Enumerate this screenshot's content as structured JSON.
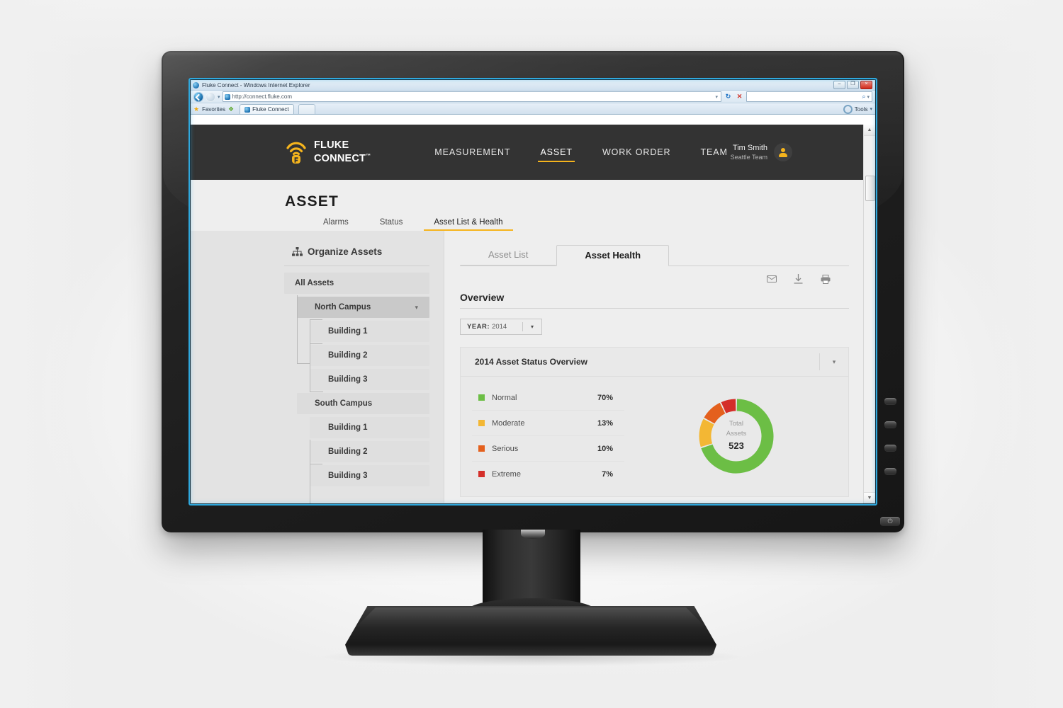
{
  "browser": {
    "window_title": "Fluke Connect - Windows Internet Explorer",
    "url": "http://connect.fluke.com",
    "favorites_label": "Favorites",
    "tab_label": "Fluke Connect",
    "tools_label": "Tools",
    "minimize_glyph": "–",
    "maximize_glyph": "❐",
    "close_glyph": "×",
    "back_caret": "▾",
    "url_caret": "▾",
    "refresh_glyph": "↻",
    "stop_glyph": "✕",
    "search_glyph": "⌕",
    "search_caret": "▾",
    "star_glyph": "★",
    "add_fav_glyph": "❖",
    "tools_caret": "▾",
    "scroll_up_glyph": "▲",
    "scroll_down_glyph": "▼"
  },
  "app": {
    "logo_line1": "FLUKE",
    "logo_line2": "CONNECT",
    "logo_tm": "™",
    "nav": [
      {
        "label": "MEASUREMENT",
        "active": false
      },
      {
        "label": "ASSET",
        "active": true
      },
      {
        "label": "WORK ORDER",
        "active": false
      },
      {
        "label": "TEAM",
        "active": false
      }
    ],
    "user": {
      "name": "Tim Smith",
      "team": "Seattle Team"
    },
    "accent": "#f5b41d",
    "header_bg": "#333333"
  },
  "page": {
    "title": "ASSET",
    "subtabs": [
      {
        "label": "Alarms",
        "active": false
      },
      {
        "label": "Status",
        "active": false
      },
      {
        "label": "Asset List & Health",
        "active": true
      }
    ]
  },
  "sidebar": {
    "heading": "Organize Assets",
    "tree": [
      {
        "label": "All Assets",
        "level": 0,
        "selected": false,
        "caret": false
      },
      {
        "label": "North Campus",
        "level": 1,
        "selected": true,
        "caret": true,
        "caret_glyph": "▾"
      },
      {
        "label": "Building 1",
        "level": 2,
        "selected": false,
        "caret": false
      },
      {
        "label": "Building 2",
        "level": 2,
        "selected": false,
        "caret": false
      },
      {
        "label": "Building 3",
        "level": 2,
        "selected": false,
        "caret": false
      },
      {
        "label": "South Campus",
        "level": 1,
        "selected": false,
        "caret": false
      },
      {
        "label": "Building 1",
        "level": 2,
        "selected": false,
        "caret": false
      },
      {
        "label": "Building 2",
        "level": 2,
        "selected": false,
        "caret": false
      },
      {
        "label": "Building 3",
        "level": 2,
        "selected": false,
        "caret": false
      }
    ]
  },
  "content": {
    "tabs": [
      {
        "label": "Asset List",
        "active": false
      },
      {
        "label": "Asset Health",
        "active": true
      }
    ],
    "actions": [
      {
        "name": "email-icon",
        "glyph": "✉"
      },
      {
        "name": "download-icon",
        "glyph": "⤓"
      },
      {
        "name": "print-icon",
        "glyph": "⎙"
      }
    ],
    "overview_heading": "Overview",
    "year_filter": {
      "label": "YEAR:",
      "value": "2014",
      "caret": "▾"
    },
    "card": {
      "title": "2014 Asset Status Overview",
      "caret": "▾"
    }
  },
  "chart_data": {
    "type": "pie",
    "title": "2014 Asset Status Overview",
    "center_label_line1": "Total",
    "center_label_line2": "Assets",
    "center_value": "523",
    "total_assets": 523,
    "unit": "%",
    "legend_position": "left",
    "categories": [
      "Normal",
      "Moderate",
      "Serious",
      "Extreme"
    ],
    "values": [
      70,
      13,
      10,
      7
    ],
    "value_labels": [
      "70%",
      "13%",
      "10%",
      "7%"
    ],
    "colors": [
      "#6cbe45",
      "#f3b734",
      "#e4601d",
      "#d42f2a"
    ]
  },
  "monitor": {
    "power_glyph": "⏻"
  }
}
